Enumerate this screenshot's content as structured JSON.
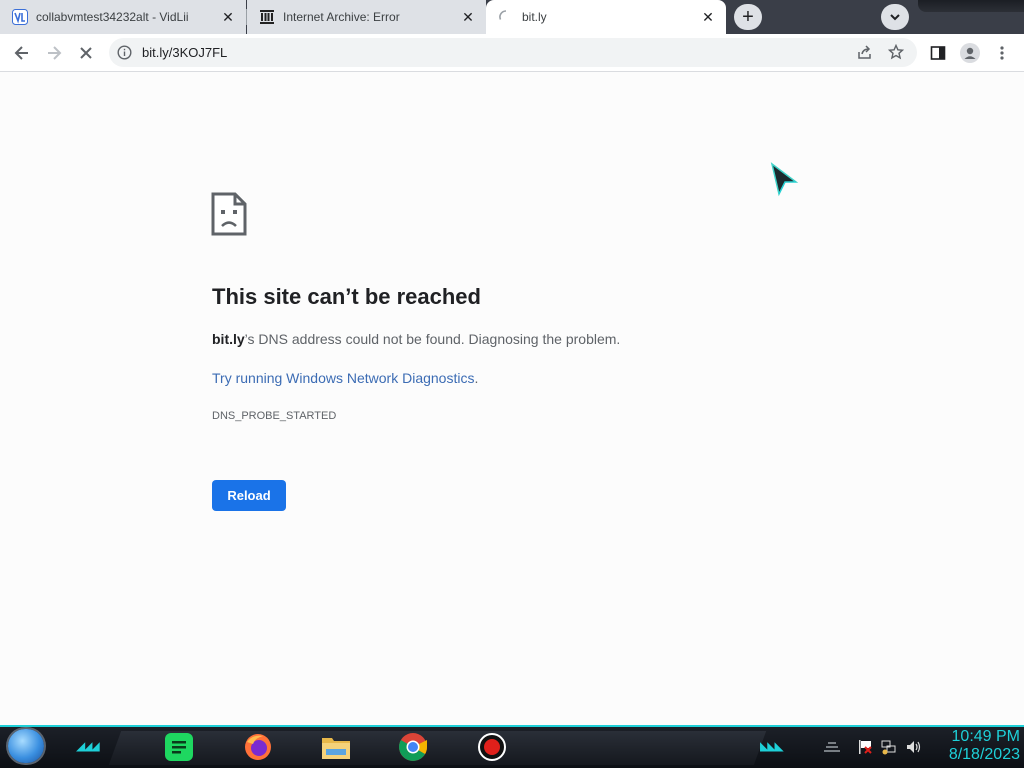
{
  "tabs": [
    {
      "title": "collabvmtest34232alt - VidLii",
      "favicon": "vidlii-icon",
      "active": false
    },
    {
      "title": "Internet Archive: Error",
      "favicon": "archive-icon",
      "active": false
    },
    {
      "title": "bit.ly",
      "favicon": "loading-spinner-icon",
      "active": true
    }
  ],
  "toolbar": {
    "url": "bit.ly/3KOJ7FL"
  },
  "error": {
    "title": "This site can’t be reached",
    "host": "bit.ly",
    "description": "’s DNS address could not be found. Diagnosing the problem.",
    "link_text": "Try running Windows Network Diagnostics",
    "link_suffix": ".",
    "code": "DNS_PROBE_STARTED",
    "reload_label": "Reload"
  },
  "taskbar": {
    "apps": [
      "spotify-icon",
      "firefox-icon",
      "file-explorer-icon",
      "chrome-icon",
      "record-icon"
    ],
    "time": "10:49 PM",
    "date": "8/18/2023"
  },
  "colors": {
    "accent": "#1a73e8",
    "link": "#3c6cb4",
    "clock": "#1ed0d8"
  }
}
